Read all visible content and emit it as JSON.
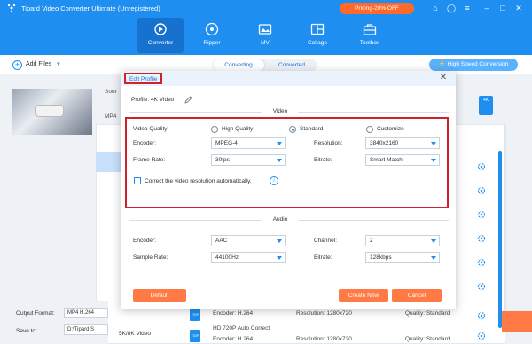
{
  "app": {
    "title": "Tipard Video Converter Ultimate (Unregistered)",
    "promo": "Pricing-20% OFF",
    "nav": [
      {
        "label": "Converter",
        "icon": "converter-icon",
        "active": true
      },
      {
        "label": "Ripper",
        "icon": "disc-icon"
      },
      {
        "label": "MV",
        "icon": "mv-icon"
      },
      {
        "label": "Collage",
        "icon": "collage-icon"
      },
      {
        "label": "Toolbox",
        "icon": "toolbox-icon"
      }
    ]
  },
  "toolbar": {
    "add_files": "Add Files",
    "tabs": [
      "Converting",
      "Converted"
    ],
    "high_speed": "High Speed Conversion"
  },
  "background": {
    "source_label": "Sour",
    "format_label": "MP4",
    "format_badge": "4K",
    "output_format_label": "Output Format:",
    "output_format_value": "MP4 H.264",
    "save_to_label": "Save to:",
    "save_to_value": "D:\\Tipard S",
    "category": "5K/8K Video",
    "rows": [
      {
        "name": "",
        "encoder": "Encoder: H.264",
        "resolution": "Resolution: 1280x720",
        "quality": "Quality: Standard",
        "icon_text": "720P"
      },
      {
        "name": "HD 720P Auto Correct",
        "encoder": "Encoder: H.264",
        "resolution": "Resolution: 1280x720",
        "quality": "Quality: Standard",
        "icon_text": "720P"
      }
    ]
  },
  "modal": {
    "title": "Edit Profile",
    "profile": "Profile: 4K Video",
    "video_section": "Video",
    "audio_section": "Audio",
    "video": {
      "quality_label": "Video Quality:",
      "quality_options": [
        "High Quality",
        "Standard",
        "Customize"
      ],
      "quality_selected": "Standard",
      "encoder_label": "Encoder:",
      "encoder_value": "MPEG-4",
      "resolution_label": "Resolution:",
      "resolution_value": "3840x2160",
      "frame_rate_label": "Frame Rate:",
      "frame_rate_value": "30fps",
      "bitrate_label": "Bitrate:",
      "bitrate_value": "Smart Match",
      "auto_correct_label": "Correct the video resolution automatically.",
      "auto_correct_checked": false
    },
    "audio": {
      "encoder_label": "Encoder:",
      "encoder_value": "AAC",
      "channel_label": "Channel:",
      "channel_value": "2",
      "sample_rate_label": "Sample Rate:",
      "sample_rate_value": "44100Hz",
      "bitrate_label": "Bitrate:",
      "bitrate_value": "128kbps"
    },
    "buttons": {
      "default": "Default",
      "create_new": "Create New",
      "cancel": "Cancel"
    }
  },
  "colors": {
    "brand_blue": "#1f8ef1",
    "accent_orange": "#ff7a45",
    "highlight_red": "#d0202a"
  }
}
